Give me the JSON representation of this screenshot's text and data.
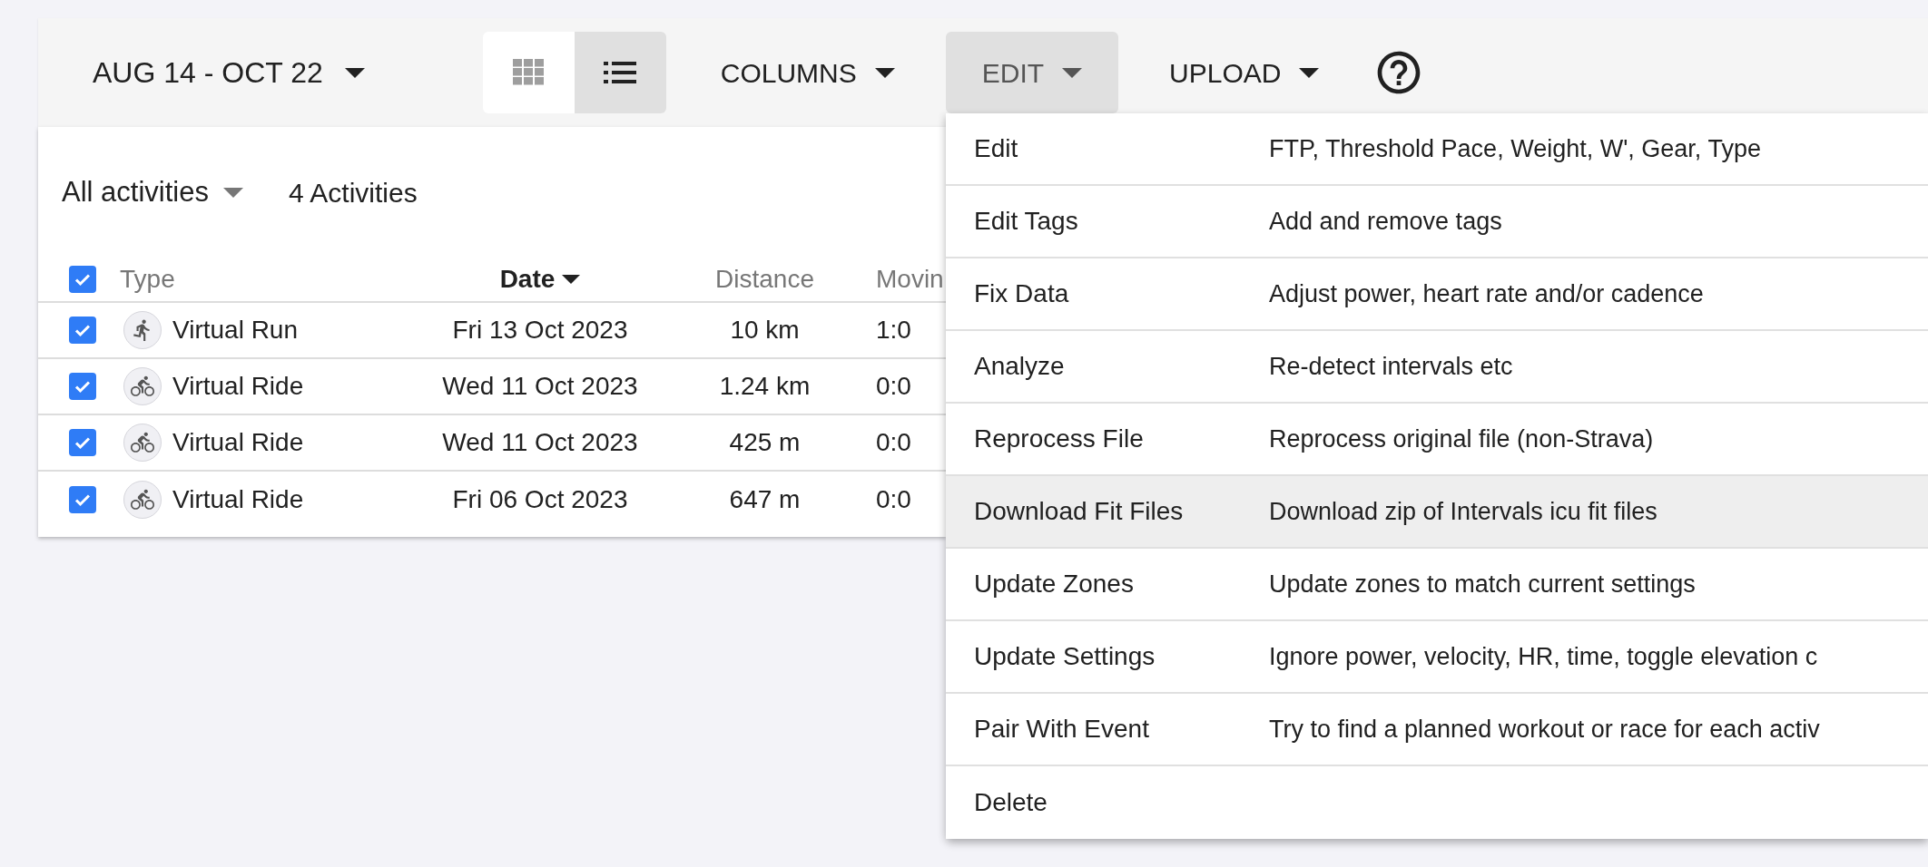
{
  "toolbar": {
    "date_range": "AUG 14 - OCT 22",
    "view_toggle": [
      {
        "kind": "grid",
        "selected": false
      },
      {
        "kind": "list",
        "selected": true
      }
    ],
    "menus": [
      {
        "label": "COLUMNS",
        "open": false
      },
      {
        "label": "EDIT",
        "open": true
      },
      {
        "label": "UPLOAD",
        "open": false
      }
    ]
  },
  "filter": {
    "label": "All activities",
    "count": "4 Activities"
  },
  "table": {
    "select_all_checked": true,
    "columns": [
      {
        "label": "Type",
        "sorted": false
      },
      {
        "label": "Date",
        "sorted": true
      },
      {
        "label": "Distance",
        "sorted": false
      },
      {
        "label": "Movin",
        "sorted": false
      }
    ],
    "rows": [
      {
        "kind": "run",
        "checked": true,
        "type": "Virtual Run",
        "date": "Fri 13 Oct 2023",
        "distance": "10 km",
        "column_4": "1:0"
      },
      {
        "kind": "ride",
        "checked": true,
        "type": "Virtual Ride",
        "date": "Wed 11 Oct 2023",
        "distance": "1.24 km",
        "column_4": "0:0"
      },
      {
        "kind": "ride",
        "checked": true,
        "type": "Virtual Ride",
        "date": "Wed 11 Oct 2023",
        "distance": "425 m",
        "column_4": "0:0"
      },
      {
        "kind": "ride",
        "checked": true,
        "type": "Virtual Ride",
        "date": "Fri 06 Oct 2023",
        "distance": "647 m",
        "column_4": "0:0"
      }
    ]
  },
  "edit_menu": [
    {
      "label": "Edit",
      "description": "FTP, Threshold Pace, Weight, W', Gear, Type",
      "selected": false
    },
    {
      "label": "Edit Tags",
      "description": "Add and remove tags",
      "selected": false
    },
    {
      "label": "Fix Data",
      "description": "Adjust power, heart rate and/or cadence",
      "selected": false
    },
    {
      "label": "Analyze",
      "description": "Re-detect intervals etc",
      "selected": false
    },
    {
      "label": "Reprocess File",
      "description": "Reprocess original file (non-Strava)",
      "selected": false
    },
    {
      "label": "Download Fit Files",
      "description": "Download zip of Intervals icu fit files",
      "selected": true
    },
    {
      "label": "Update Zones",
      "description": "Update zones to match current settings",
      "selected": false
    },
    {
      "label": "Update Settings",
      "description": "Ignore power, velocity, HR, time, toggle elevation c",
      "selected": false
    },
    {
      "label": "Pair With Event",
      "description": "Try to find a planned workout or race for each activ",
      "selected": false
    },
    {
      "label": "Delete",
      "selected": false
    }
  ]
}
